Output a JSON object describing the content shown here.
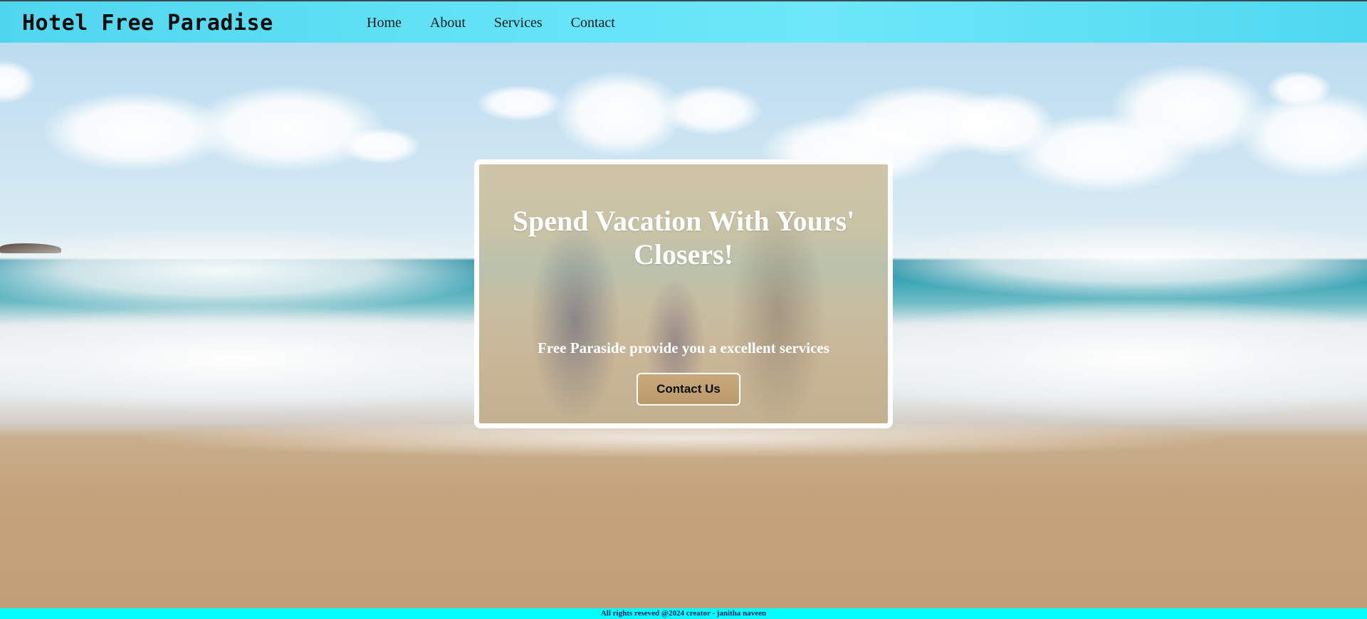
{
  "header": {
    "brand": "Hotel Free Paradise",
    "nav": [
      {
        "label": "Home"
      },
      {
        "label": "About"
      },
      {
        "label": "Services"
      },
      {
        "label": "Contact"
      }
    ],
    "background_color": "#5fe0f5"
  },
  "hero": {
    "background_description_icon": "beach-photo",
    "card": {
      "title": "Spend Vacation With Yours' Closers!",
      "subtitle": "Free Paraside provide you a excellent services",
      "button_label": "Contact Us",
      "button_color": "#c2a274"
    }
  },
  "footer": {
    "text": "All rights reseved @2024 creator - janitha naveen",
    "background_color": "#00ffff"
  }
}
